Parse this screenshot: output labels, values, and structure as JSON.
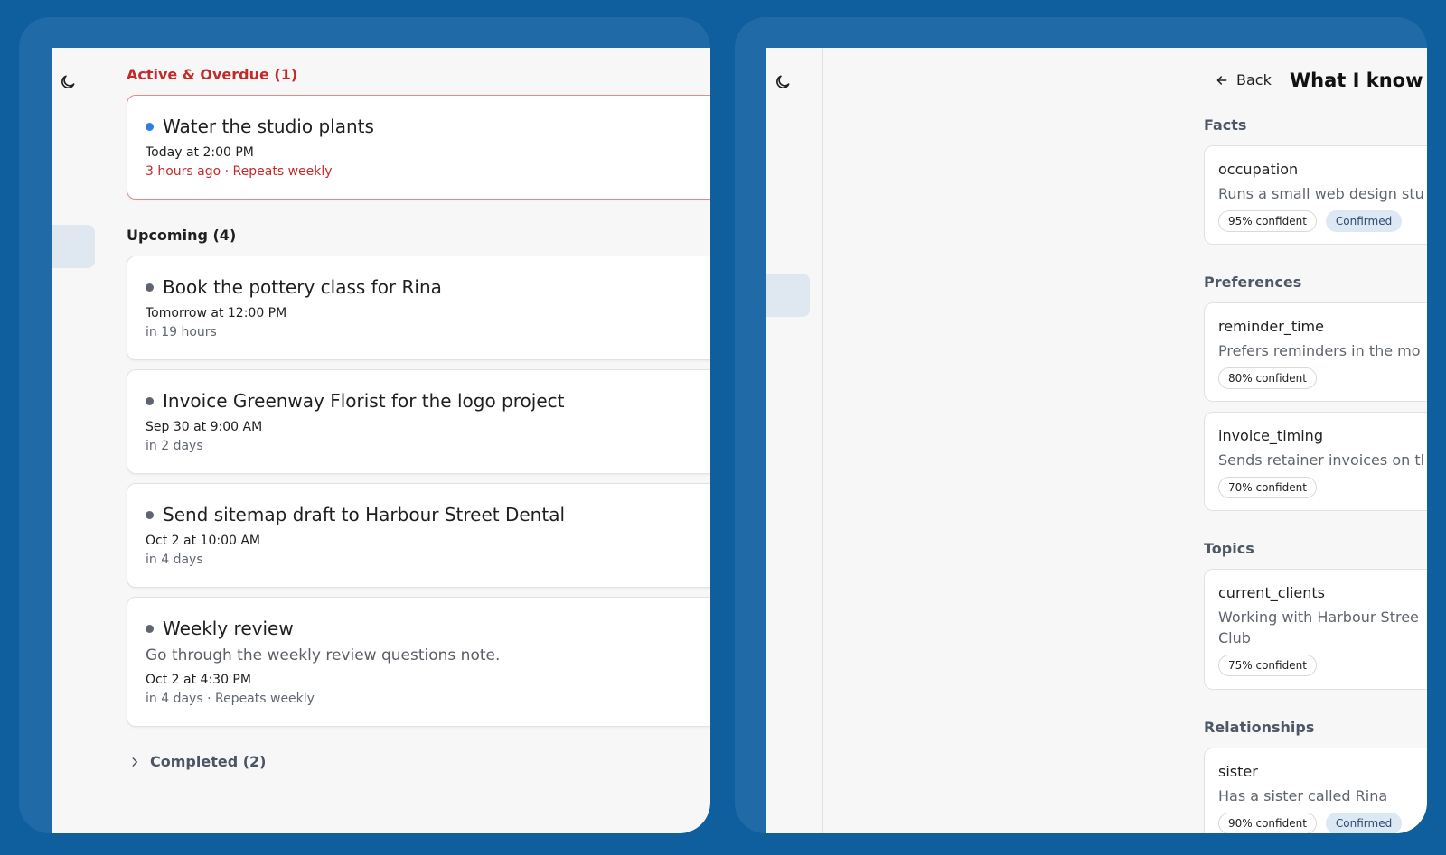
{
  "colors": {
    "background": "#0f5e9e",
    "frame": "#216aa8",
    "overdue": "#c52a2a",
    "accent_dot": "#2f7de1"
  },
  "left": {
    "active_section": "Active & Overdue (1)",
    "active_items": [
      {
        "title": "Water the studio plants",
        "date": "Today at 2:00 PM",
        "meta": "3 hours ago · Repeats weekly",
        "dot_icon": "blue-dot-icon"
      }
    ],
    "upcoming_section": "Upcoming (4)",
    "upcoming_items": [
      {
        "title": "Book the pottery class for Rina",
        "date": "Tomorrow at 12:00 PM",
        "meta": "in 19 hours"
      },
      {
        "title": "Invoice Greenway Florist for the logo project",
        "date": "Sep 30 at 9:00 AM",
        "meta": "in 2 days"
      },
      {
        "title": "Send sitemap draft to Harbour Street Dental",
        "date": "Oct 2 at 10:00 AM",
        "meta": "in 4 days"
      },
      {
        "title": "Weekly review",
        "description": "Go through the weekly review questions note.",
        "date": "Oct 2 at 4:30 PM",
        "meta": "in 4 days · Repeats weekly"
      }
    ],
    "completed_label": "Completed (2)"
  },
  "right": {
    "back_label": "Back",
    "title": "What I know",
    "categories": {
      "facts": {
        "label": "Facts",
        "items": [
          {
            "key": "occupation",
            "value": "Runs a small web design stu",
            "confidence": "95% confident",
            "status": "Confirmed"
          }
        ]
      },
      "preferences": {
        "label": "Preferences",
        "items": [
          {
            "key": "reminder_time",
            "value": "Prefers reminders in the mo",
            "confidence": "80% confident"
          },
          {
            "key": "invoice_timing",
            "value": "Sends retainer invoices on tl",
            "confidence": "70% confident"
          }
        ]
      },
      "topics": {
        "label": "Topics",
        "items": [
          {
            "key": "current_clients",
            "value": "Working with Harbour Stree Club",
            "confidence": "75% confident"
          }
        ]
      },
      "relationships": {
        "label": "Relationships",
        "items": [
          {
            "key": "sister",
            "value": "Has a sister called Rina",
            "confidence": "90% confident",
            "status": "Confirmed"
          }
        ]
      }
    }
  }
}
